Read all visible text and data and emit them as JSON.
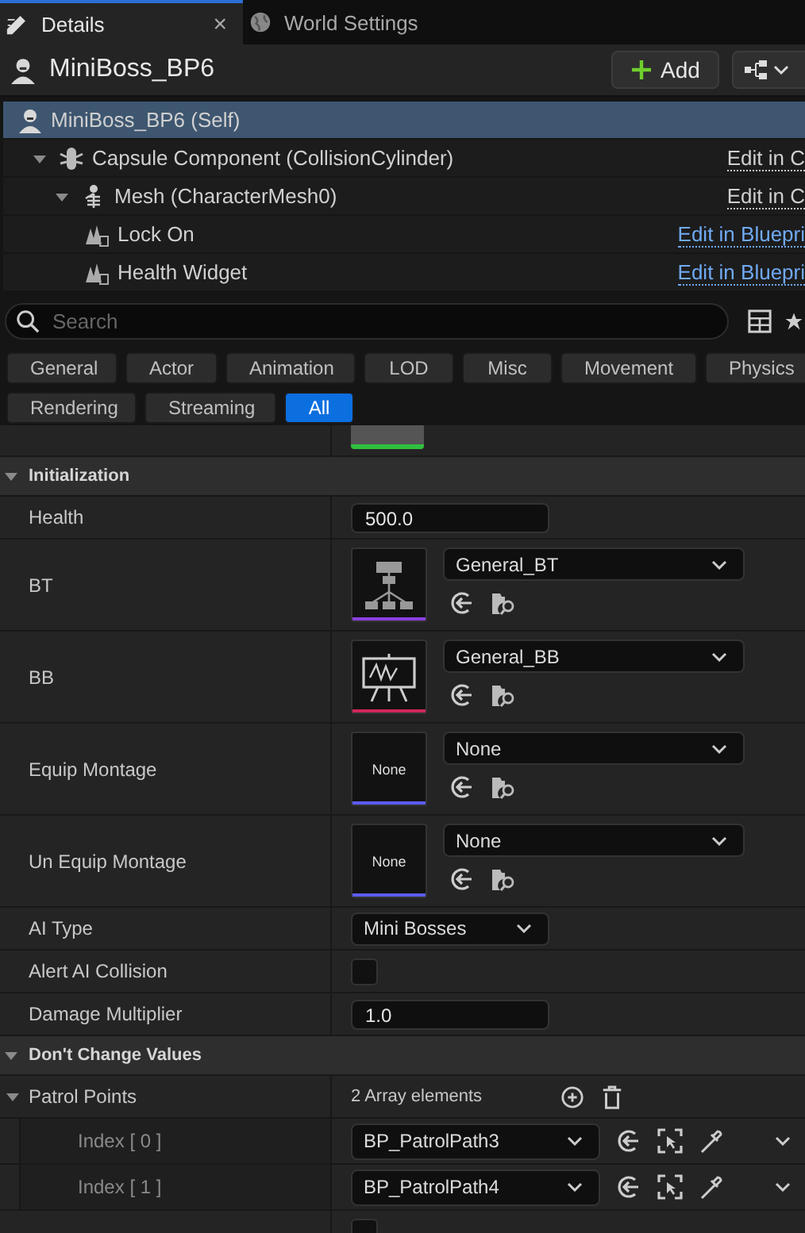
{
  "tabs": [
    {
      "label": "Details",
      "selected": true,
      "close": "×"
    },
    {
      "label": "World Settings",
      "selected": false
    }
  ],
  "header": {
    "title": "MiniBoss_BP6",
    "add_label": "Add"
  },
  "components": [
    {
      "label": "MiniBoss_BP6 (Self)",
      "kind": "actor",
      "selected": true,
      "children": [
        {
          "label": "Capsule Component (CollisionCylinder)",
          "kind": "capsule",
          "selected": false,
          "expanded": true,
          "link": {
            "text": "Edit in C",
            "kind": "native"
          },
          "children": [
            {
              "label": "Mesh (CharacterMesh0)",
              "kind": "mesh",
              "selected": false,
              "expanded": true,
              "link": {
                "text": "Edit in C",
                "kind": "native"
              },
              "children": [
                {
                  "label": "Lock On",
                  "kind": "widget",
                  "selected": false,
                  "link": {
                    "text": "Edit in Bluepri",
                    "kind": "blueprint"
                  }
                },
                {
                  "label": "Health Widget",
                  "kind": "widget",
                  "selected": false,
                  "link": {
                    "text": "Edit in Bluepri",
                    "kind": "blueprint"
                  }
                }
              ]
            }
          ]
        }
      ]
    }
  ],
  "search": {
    "placeholder": "Search"
  },
  "filters": [
    {
      "label": "General",
      "selected": false
    },
    {
      "label": "Actor",
      "selected": false
    },
    {
      "label": "Animation",
      "selected": false
    },
    {
      "label": "LOD",
      "selected": false
    },
    {
      "label": "Misc",
      "selected": false
    },
    {
      "label": "Movement",
      "selected": false
    },
    {
      "label": "Physics",
      "selected": false
    },
    {
      "label": "Rendering",
      "selected": false
    },
    {
      "label": "Streaming",
      "selected": false
    },
    {
      "label": "All",
      "selected": true
    }
  ],
  "sections": [
    {
      "title": "Initialization",
      "expanded": true,
      "rows": [
        {
          "kind": "number",
          "label": "Health",
          "value": "500.0"
        },
        {
          "kind": "asset",
          "label": "BT",
          "value": "General_BT",
          "thumbnail": {
            "kind": "tree"
          },
          "color": "#8b3fe0"
        },
        {
          "kind": "asset",
          "label": "BB",
          "value": "General_BB",
          "thumbnail": {
            "kind": "board"
          },
          "color": "#d0265a"
        },
        {
          "kind": "asset",
          "label": "Equip Montage",
          "value": "None",
          "thumbnail": {
            "kind": "text",
            "text": "None"
          },
          "color": "#5b5cf2"
        },
        {
          "kind": "asset",
          "label": "Un Equip Montage",
          "value": "None",
          "thumbnail": {
            "kind": "text",
            "text": "None"
          },
          "color": "#5b5cf2"
        },
        {
          "kind": "enum",
          "label": "AI Type",
          "value": "Mini Bosses"
        },
        {
          "kind": "checkbox",
          "label": "Alert AI Collision",
          "checked": false
        },
        {
          "kind": "number",
          "label": "Damage Multiplier",
          "value": "1.0"
        }
      ]
    },
    {
      "title": "Don't Change Values",
      "expanded": true,
      "rows": [
        {
          "kind": "array",
          "label": "Patrol Points",
          "value": "2 Array elements",
          "expanded": true,
          "children": [
            {
              "kind": "item",
              "label": "Index [ 0 ]",
              "value": "BP_PatrolPath3"
            },
            {
              "kind": "item",
              "label": "Index [ 1 ]",
              "value": "BP_PatrolPath4"
            }
          ]
        },
        {
          "kind": "checkbox",
          "checked": false
        }
      ]
    }
  ]
}
